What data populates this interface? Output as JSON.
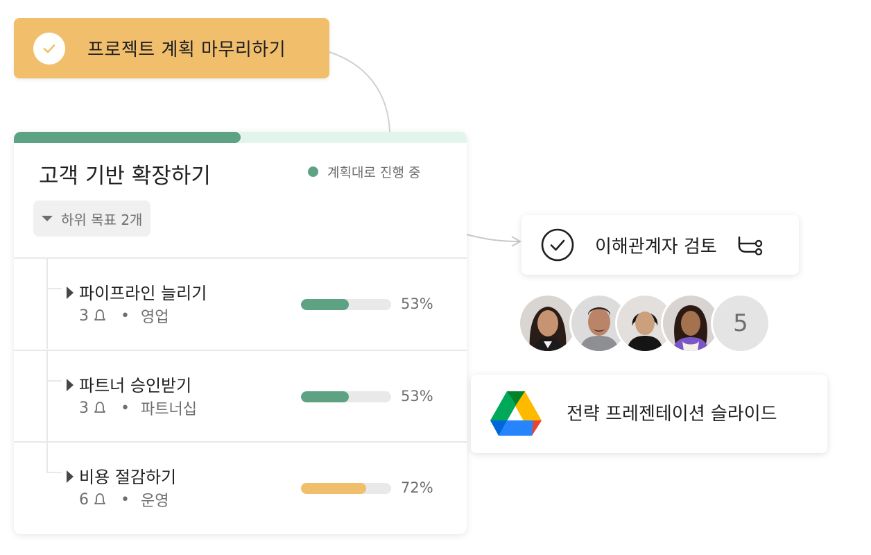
{
  "task": {
    "label": "프로젝트 계획 마무리하기"
  },
  "goal": {
    "title": "고객 기반 확장하기",
    "status": "계획대로 진행 중",
    "status_color": "#5da283",
    "progress": 0.5,
    "subgoal_toggle": "하위 목표 2개",
    "rows": [
      {
        "name": "파이프라인 늘리기",
        "count": "3",
        "team": "영업",
        "percent_label": "53%",
        "percent": 53,
        "color": "#5da283"
      },
      {
        "name": "파트너 승인받기",
        "count": "3",
        "team": "파트너십",
        "percent_label": "53%",
        "percent": 53,
        "color": "#5da283"
      },
      {
        "name": "비용 절감하기",
        "count": "6",
        "team": "운영",
        "percent_label": "72%",
        "percent": 72,
        "color": "#f1be6c"
      }
    ]
  },
  "review": {
    "label": "이해관계자 검토",
    "icon": "check-circle-icon",
    "action_icon": "approval-icon"
  },
  "avatars": {
    "people": [
      "avatar-1",
      "avatar-2",
      "avatar-3",
      "avatar-4"
    ],
    "more_count": "5"
  },
  "drive": {
    "label": "전략 프레젠테이션 슬라이드",
    "icon": "google-drive-icon"
  }
}
